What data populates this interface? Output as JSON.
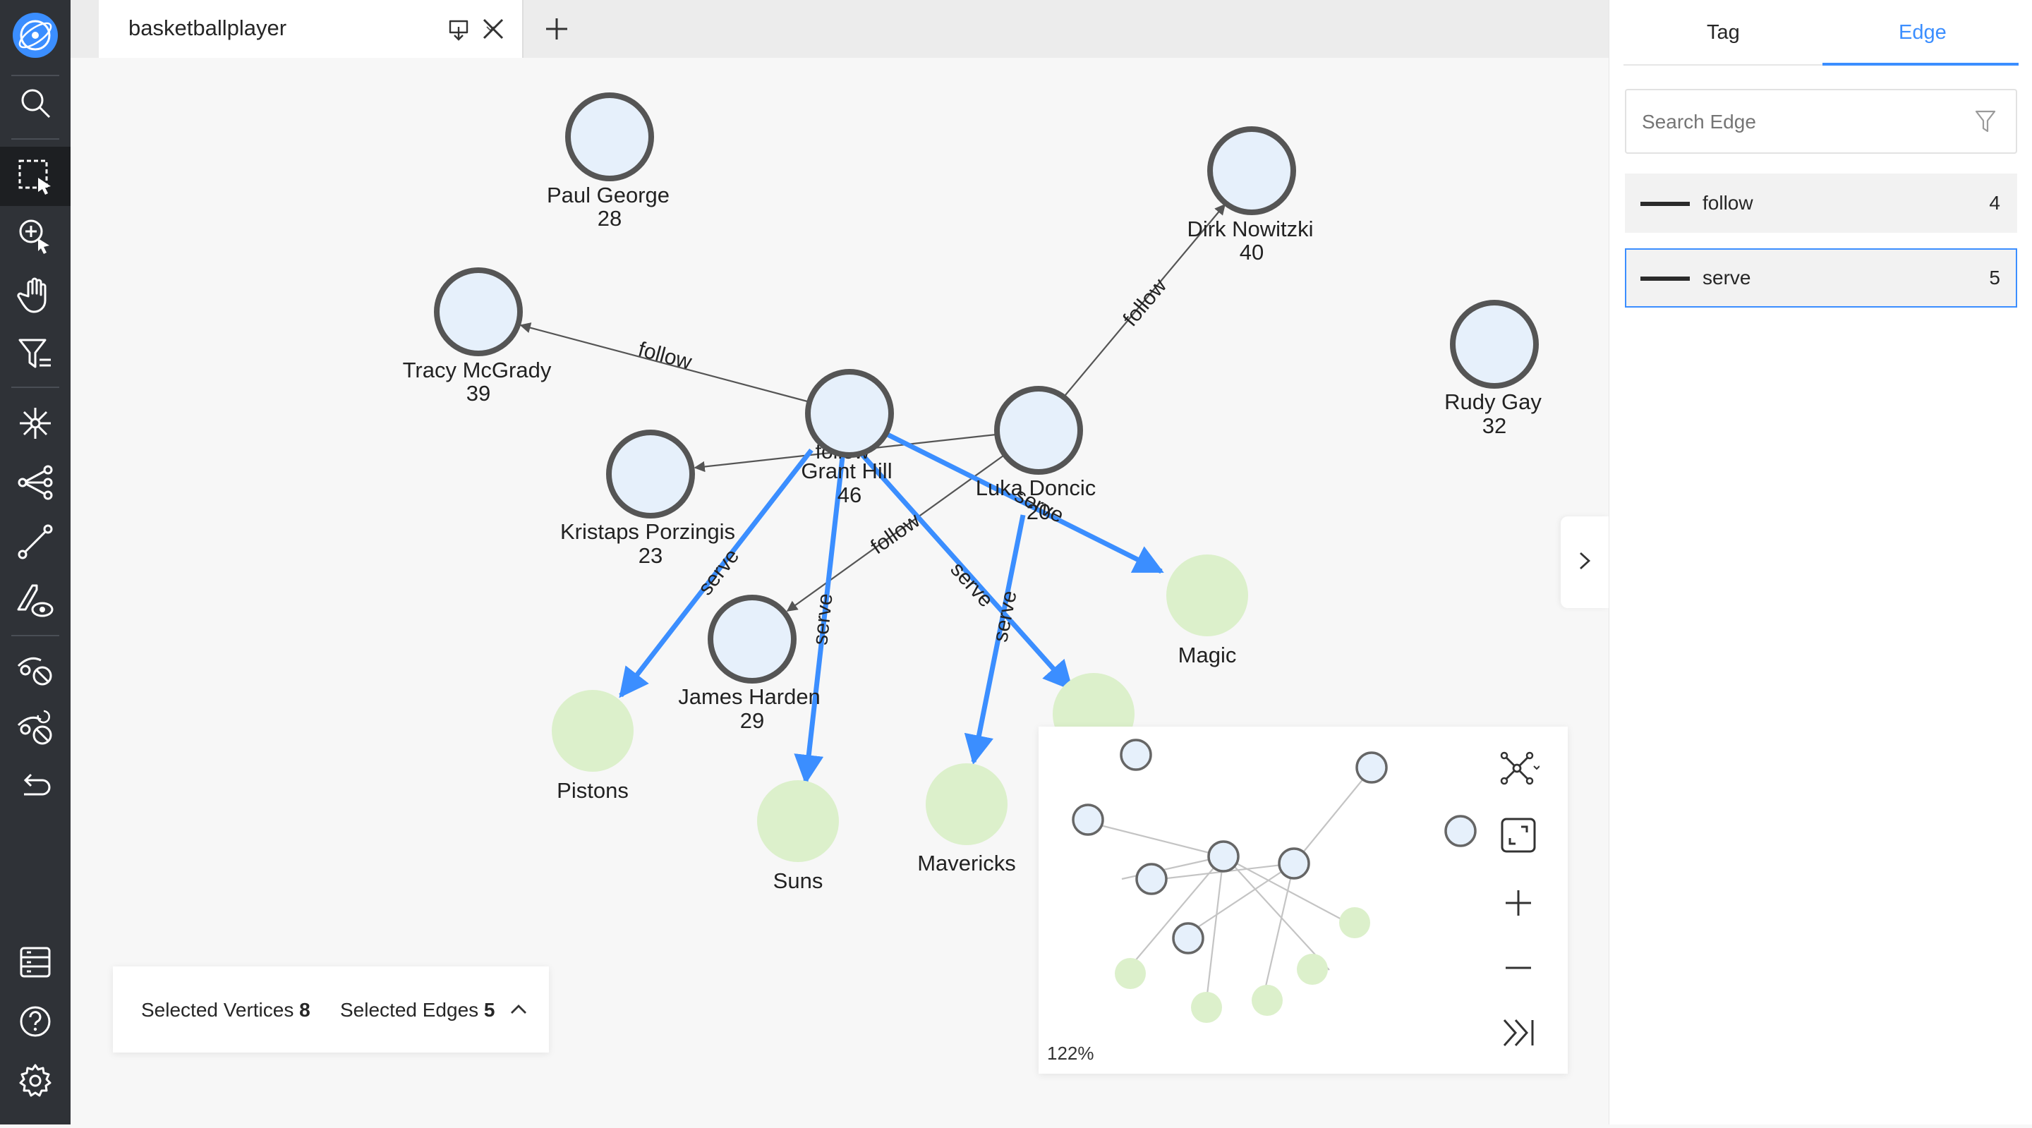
{
  "tab": {
    "title": "basketballplayer"
  },
  "graph": {
    "vertices": [
      {
        "name": "Paul George",
        "age": "28"
      },
      {
        "name": "Dirk Nowitzki",
        "age": "40"
      },
      {
        "name": "Tracy McGrady",
        "age": "39"
      },
      {
        "name": "Rudy Gay",
        "age": "32"
      },
      {
        "name": "Grant Hill",
        "age": "46"
      },
      {
        "name": "Luka Doncic",
        "age": "20"
      },
      {
        "name": "Kristaps Porzingis",
        "age": "23"
      },
      {
        "name": "James Harden",
        "age": "29"
      }
    ],
    "teams": [
      "Magic",
      "Pistons",
      "Suns",
      "Mavericks"
    ],
    "edge_labels": {
      "follow": "follow",
      "serve": "serve"
    },
    "hidden_label_fragment": "follow"
  },
  "right_panel": {
    "tabs": [
      "Tag",
      "Edge"
    ],
    "active_tab": "Edge",
    "search_placeholder": "Search Edge",
    "edges": [
      {
        "name": "follow",
        "count": "4"
      },
      {
        "name": "serve",
        "count": "5"
      }
    ]
  },
  "selection": {
    "vertices_label": "Selected Vertices",
    "vertices_count": "8",
    "edges_label": "Selected Edges",
    "edges_count": "5"
  },
  "minimap": {
    "zoom": "122%"
  },
  "colors": {
    "accent": "#3b8eff",
    "sidebar": "#2f3237",
    "vertex_fill": "#e6f0fb",
    "vertex_stroke": "#555555",
    "team_fill": "#dcf0cb",
    "edge": "#555555"
  },
  "icons": {
    "sidebar": [
      "logo-icon",
      "search-icon",
      "box-select-icon",
      "zoom-select-icon",
      "pan-hand-icon",
      "filter-icon",
      "graph-layout-icon",
      "expand-icon",
      "path-icon",
      "inspect-icon",
      "hide-icon",
      "hide-refresh-icon",
      "undo-icon",
      "config-icon",
      "help-icon",
      "settings-icon"
    ],
    "tab": [
      "download-icon",
      "chevron-down-icon",
      "close-icon",
      "add-tab-icon"
    ],
    "minimap": [
      "layout-icon",
      "fit-view-icon",
      "zoom-in-icon",
      "zoom-out-icon",
      "expand-panel-icon"
    ]
  }
}
